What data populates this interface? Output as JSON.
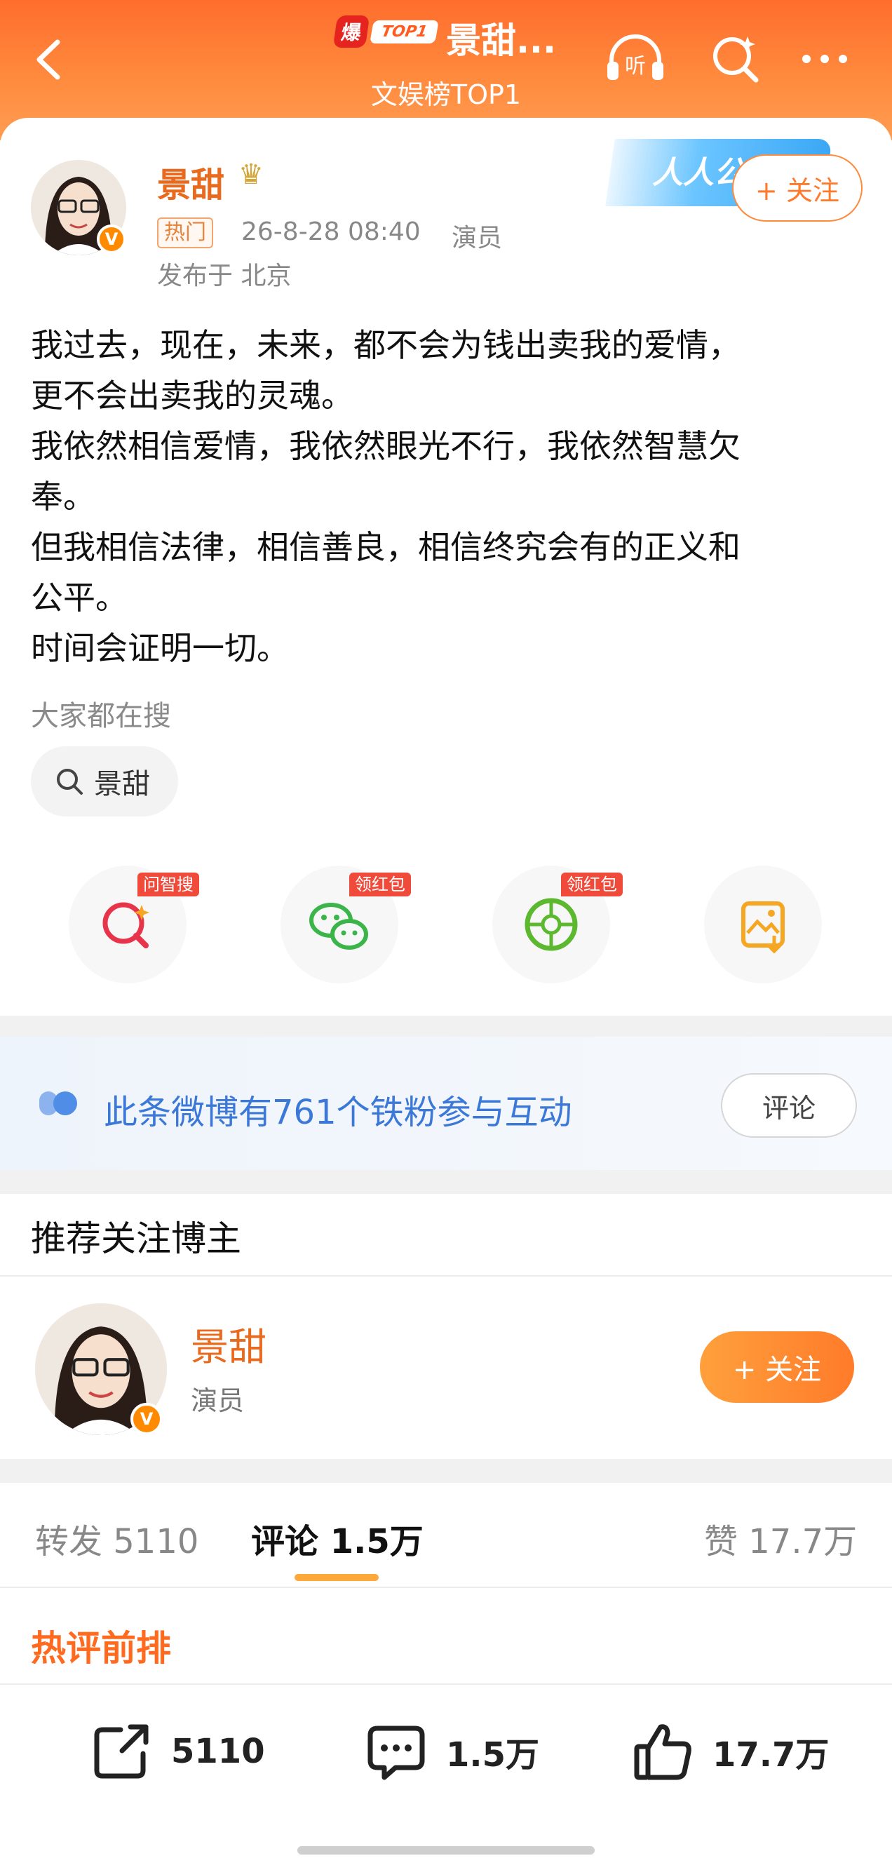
{
  "header": {
    "badge_bao": "爆",
    "badge_top": "TOP1",
    "title": "景甜...",
    "subtitle": "文娱榜TOP1",
    "icons": [
      "back-arrow-icon",
      "listen-icon",
      "search-icon",
      "more-icon"
    ],
    "listen_label": "听",
    "accent": "#ff7a2a"
  },
  "post": {
    "author": "景甜",
    "hot_tag": "热门",
    "time": "26-8-28 08:40",
    "role": "演员",
    "location": "发布于 北京",
    "campaign": "人人公益",
    "follow_label": "+ 关注",
    "lines": [
      "我过去，现在，未来，都不会为钱出卖我的爱情，",
      "更不会出卖我的灵魂。",
      "我依然相信爱情，我依然眼光不行，我依然智慧欠",
      "奉。",
      "但我相信法律，相信善良，相信终究会有的正义和",
      "公平。",
      "时间会证明一切。"
    ],
    "search_hint": "大家都在搜",
    "search_chip": "景甜"
  },
  "share": [
    {
      "name": "ask-search",
      "tag": "问智搜",
      "icon": "ai-search-icon"
    },
    {
      "name": "wechat",
      "tag": "领红包",
      "icon": "wechat-icon"
    },
    {
      "name": "moments",
      "tag": "领红包",
      "icon": "moments-icon"
    },
    {
      "name": "save-image",
      "tag": "",
      "icon": "save-image-icon"
    }
  ],
  "fans": {
    "text": "此条微博有761个铁粉参与互动",
    "comment_label": "评论"
  },
  "recommend": {
    "title": "推荐关注博主",
    "name": "景甜",
    "role": "演员",
    "follow_label": "+ 关注"
  },
  "tabs": {
    "repost": "转发 5110",
    "comment": "评论 1.5万",
    "like": "赞 17.7万"
  },
  "hot_comments_title": "热评前排",
  "actions": {
    "repost": "5110",
    "comment": "1.5万",
    "like": "17.7万"
  }
}
